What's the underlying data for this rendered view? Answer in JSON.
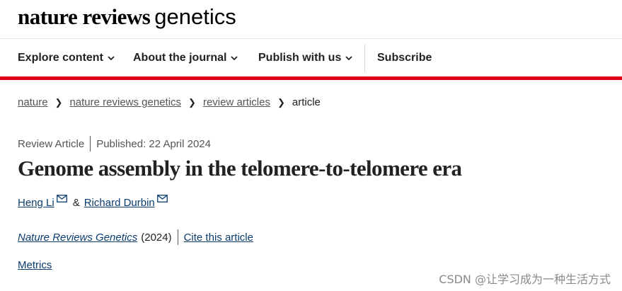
{
  "header": {
    "logo_bold": "nature reviews",
    "logo_light": "genetics"
  },
  "nav": {
    "items": [
      {
        "label": "Explore content",
        "icon": "chevron-down-icon"
      },
      {
        "label": "About the journal",
        "icon": "chevron-down-icon"
      },
      {
        "label": "Publish with us",
        "icon": "chevron-down-icon"
      },
      {
        "label": "Subscribe"
      }
    ],
    "accent_color": "#e0001a"
  },
  "breadcrumb": [
    "nature",
    "nature reviews genetics",
    "review articles",
    "article"
  ],
  "article": {
    "type": "Review Article",
    "published": "Published: 22 April 2024",
    "title": "Genome assembly in the telomere-to-telomere era",
    "authors": [
      {
        "name": "Heng Li",
        "icon": "mail-icon"
      },
      {
        "name": "Richard Durbin",
        "icon": "mail-icon"
      }
    ],
    "author_sep": "&",
    "journal_name": "Nature Reviews Genetics",
    "journal_year": "(2024)",
    "cite_label": "Cite this article",
    "metrics_label": "Metrics"
  },
  "watermark": "CSDN @让学习成为一种生活方式"
}
